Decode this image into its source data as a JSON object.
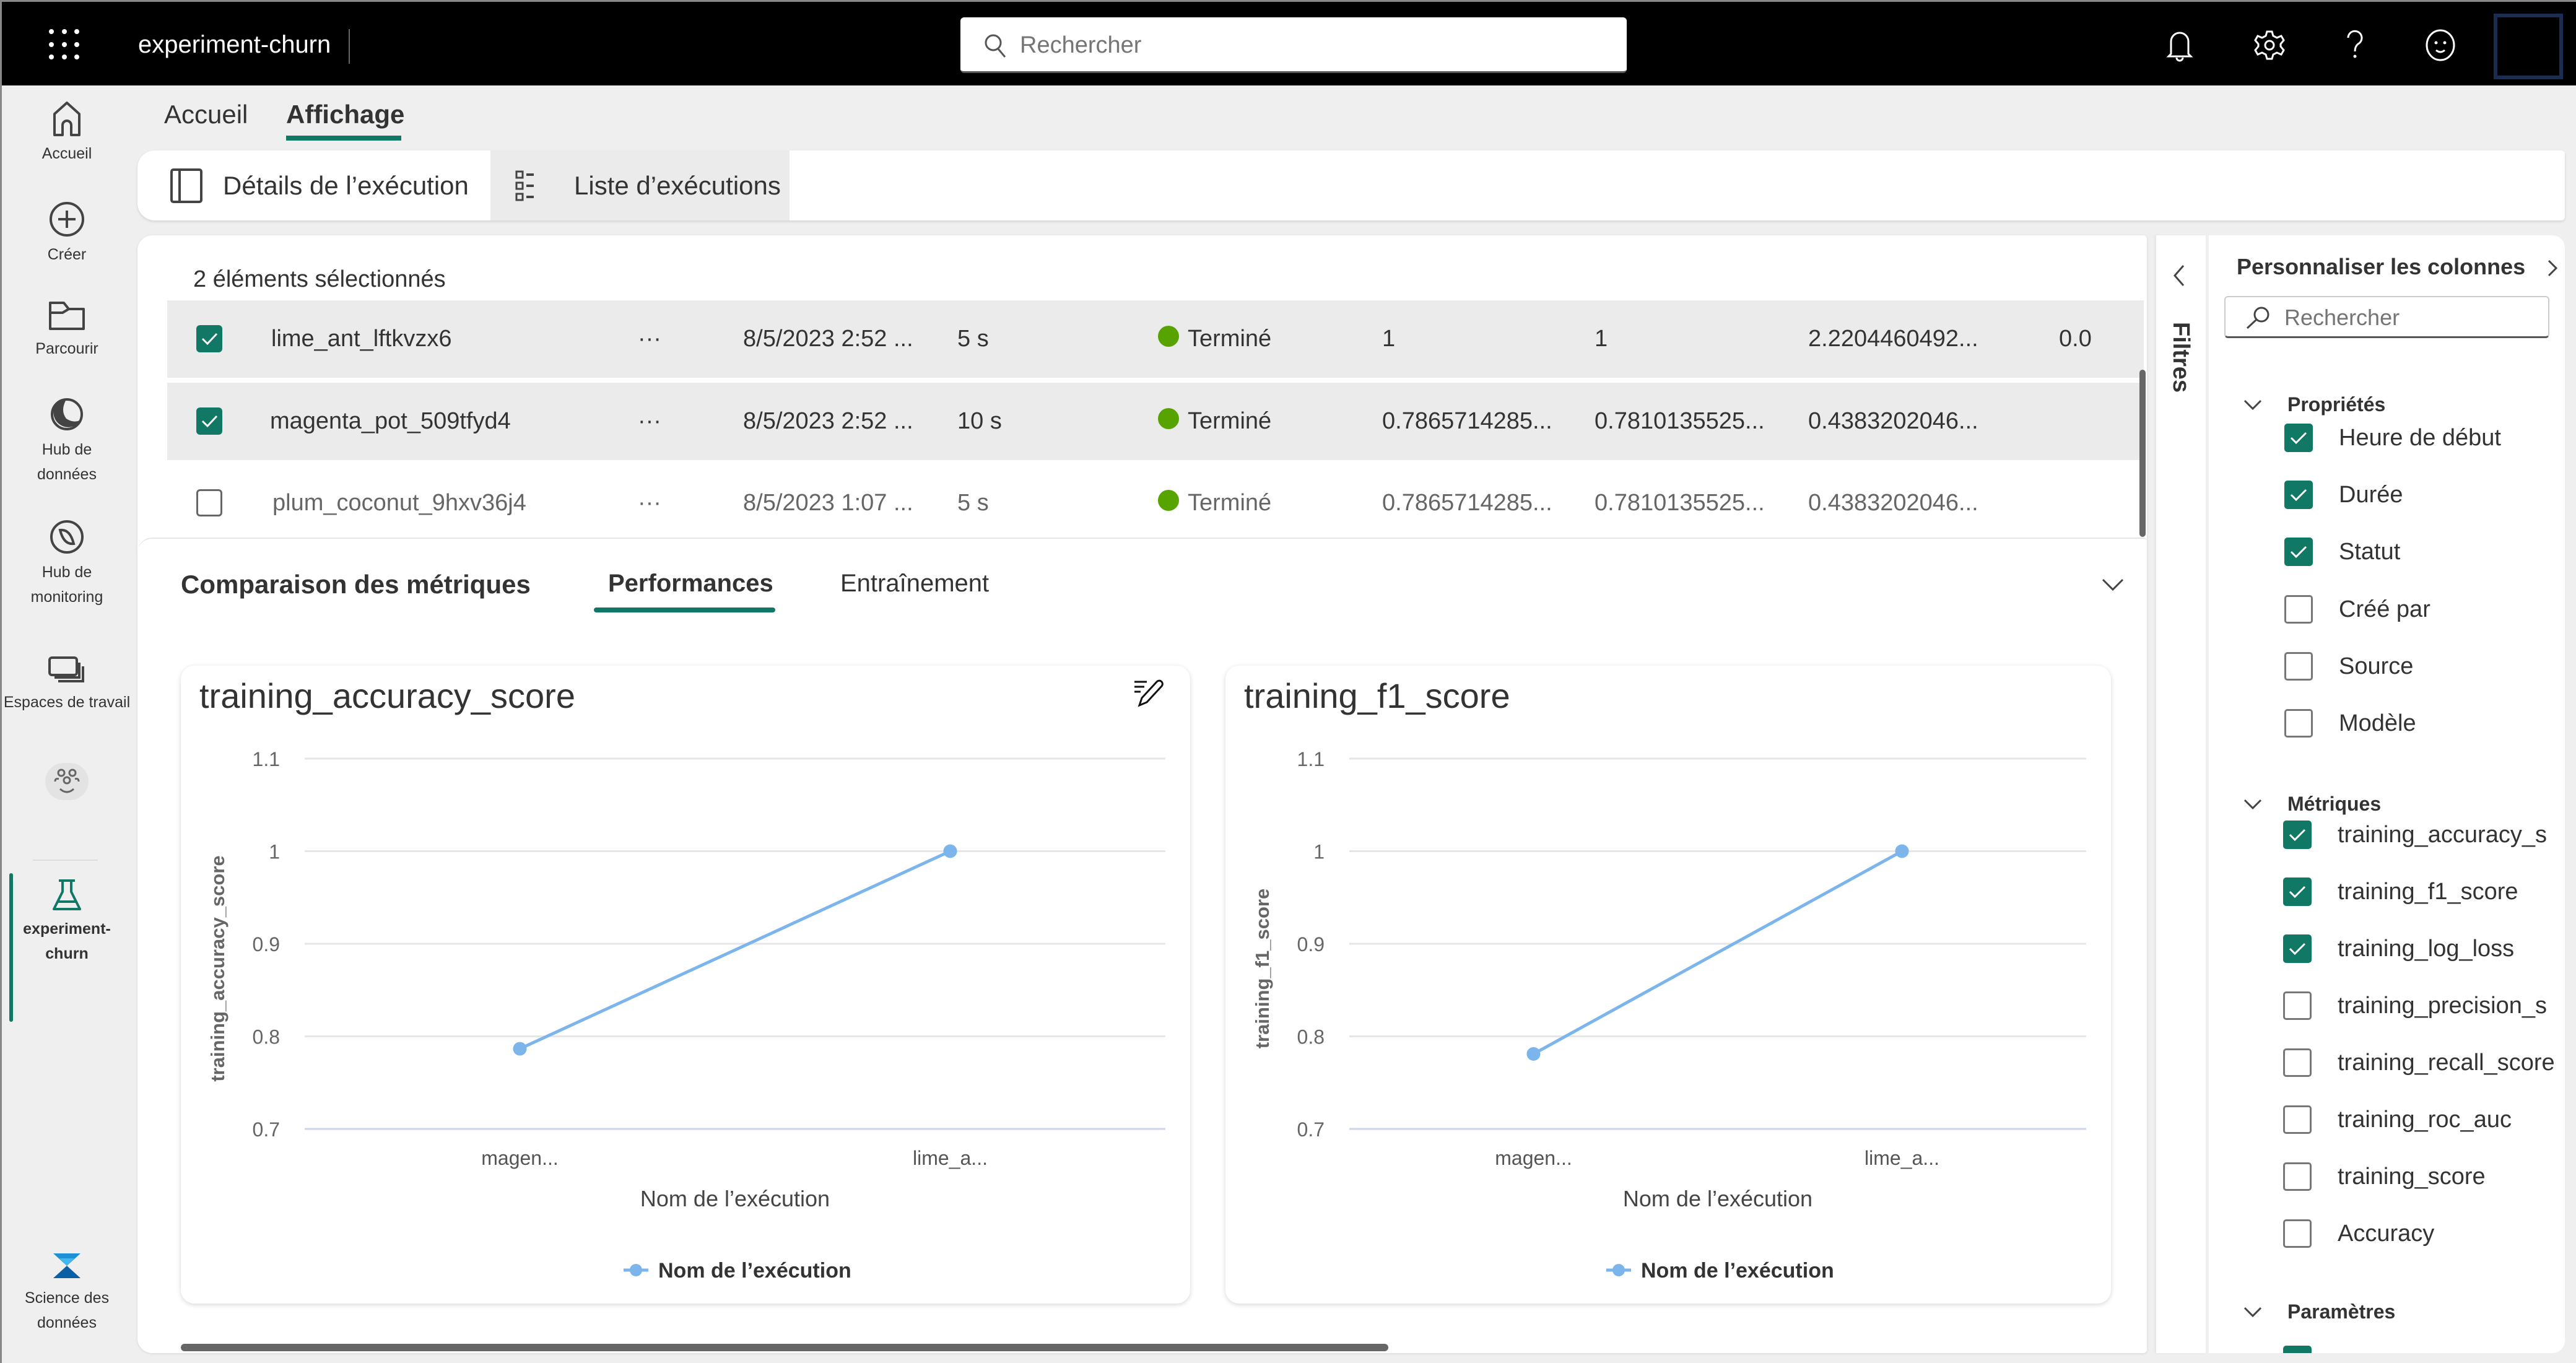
{
  "topbar": {
    "app_title": "experiment-churn",
    "search_placeholder": "Rechercher",
    "icons": [
      "waffle-icon",
      "bell-icon",
      "gear-icon",
      "help-icon",
      "feedback-smiley-icon",
      "account-avatar"
    ]
  },
  "leftnav": {
    "items": [
      {
        "label": "Accueil",
        "icon": "home-icon"
      },
      {
        "label": "Créer",
        "icon": "plus-circle-icon"
      },
      {
        "label": "Parcourir",
        "icon": "folder-icon"
      },
      {
        "label": "Hub de données",
        "icon": "data-hub-icon"
      },
      {
        "label": "Hub de monitoring",
        "icon": "monitoring-icon"
      },
      {
        "label": "Espaces de travail",
        "icon": "workspaces-icon"
      },
      {
        "label": "",
        "icon": "people-icon"
      },
      {
        "label": "experiment-churn",
        "icon": "flask-icon",
        "active": true
      },
      {
        "label": "Science des données",
        "icon": "data-science-logo"
      }
    ]
  },
  "ribbon": {
    "tabs": [
      {
        "label": "Accueil"
      },
      {
        "label": "Affichage",
        "active": true
      }
    ],
    "buttons": [
      {
        "label": "Détails de l’exécution",
        "icon": "panel-icon"
      },
      {
        "label": "Liste d’exécutions",
        "icon": "list-icon",
        "selected": true
      }
    ]
  },
  "runs": {
    "selection_text": "2 éléments sélectionnés",
    "rows": [
      {
        "selected": true,
        "name": "lime_ant_lftkvzx6",
        "more": "···",
        "start": "8/5/2023 2:52 ...",
        "duration": "5 s",
        "status": "Terminé",
        "m1": "1",
        "m2": "1",
        "m3": "2.2204460492...",
        "m4": "0.0"
      },
      {
        "selected": true,
        "name": "magenta_pot_509tfyd4",
        "more": "···",
        "start": "8/5/2023 2:52 ...",
        "duration": "10 s",
        "status": "Terminé",
        "m1": "0.7865714285...",
        "m2": "0.7810135525...",
        "m3": "0.4383202046...",
        "m4": ""
      },
      {
        "selected": false,
        "name": "plum_coconut_9hxv36j4",
        "more": "···",
        "start": "8/5/2023 1:07 ...",
        "duration": "5 s",
        "status": "Terminé",
        "m1": "0.7865714285...",
        "m2": "0.7810135525...",
        "m3": "0.4383202046...",
        "m4": ""
      }
    ]
  },
  "metrics_comparison": {
    "title": "Comparaison des métriques",
    "tabs": [
      {
        "label": "Performances",
        "active": true
      },
      {
        "label": "Entraînement"
      }
    ]
  },
  "chart_data": [
    {
      "type": "line",
      "title": "training_accuracy_score",
      "categories": [
        "magen...",
        "lime_a..."
      ],
      "series": [
        {
          "name": "Nom de l’exécution",
          "values": [
            0.7865714285,
            1.0
          ],
          "color": "#7cb5ec"
        }
      ],
      "xlabel": "Nom de l’exécution",
      "ylabel": "training_accuracy_score",
      "ylim": [
        0.7,
        1.1
      ],
      "yticks": [
        "1.1",
        "1",
        "0.9",
        "0.8",
        "0.7"
      ],
      "ytick_values": [
        1.1,
        1.0,
        0.9,
        0.8,
        0.7
      ],
      "grid": true,
      "legend": "bottom-center",
      "editable": true
    },
    {
      "type": "line",
      "title": "training_f1_score",
      "categories": [
        "magen...",
        "lime_a..."
      ],
      "series": [
        {
          "name": "Nom de l’exécution",
          "values": [
            0.7810135525,
            1.0
          ],
          "color": "#7cb5ec"
        }
      ],
      "xlabel": "Nom de l’exécution",
      "ylabel": "training_f1_score",
      "ylim": [
        0.7,
        1.1
      ],
      "yticks": [
        "1.1",
        "1",
        "0.9",
        "0.8",
        "0.7"
      ],
      "ytick_values": [
        1.1,
        1.0,
        0.9,
        0.8,
        0.7
      ],
      "grid": true,
      "legend": "bottom-center",
      "editable": false
    }
  ],
  "filters": {
    "label": "Filtres"
  },
  "columns_panel": {
    "title": "Personnaliser les colonnes",
    "search_placeholder": "Rechercher",
    "groups": [
      {
        "label": "Propriétés",
        "items": [
          {
            "label": "Heure de début",
            "checked": true
          },
          {
            "label": "Durée",
            "checked": true
          },
          {
            "label": "Statut",
            "checked": true
          },
          {
            "label": "Créé par",
            "checked": false
          },
          {
            "label": "Source",
            "checked": false
          },
          {
            "label": "Modèle",
            "checked": false
          }
        ]
      },
      {
        "label": "Métriques",
        "items": [
          {
            "label": "training_accuracy_s",
            "checked": true
          },
          {
            "label": "training_f1_score",
            "checked": true
          },
          {
            "label": "training_log_loss",
            "checked": true
          },
          {
            "label": "training_precision_s",
            "checked": false
          },
          {
            "label": "training_recall_score",
            "checked": false
          },
          {
            "label": "training_roc_auc",
            "checked": false
          },
          {
            "label": "training_score",
            "checked": false
          },
          {
            "label": "Accuracy",
            "checked": false
          }
        ]
      },
      {
        "label": "Paramètres",
        "items": []
      }
    ]
  },
  "colors": {
    "accent": "#117865",
    "status_success": "#57a300",
    "series": "#7cb5ec"
  }
}
